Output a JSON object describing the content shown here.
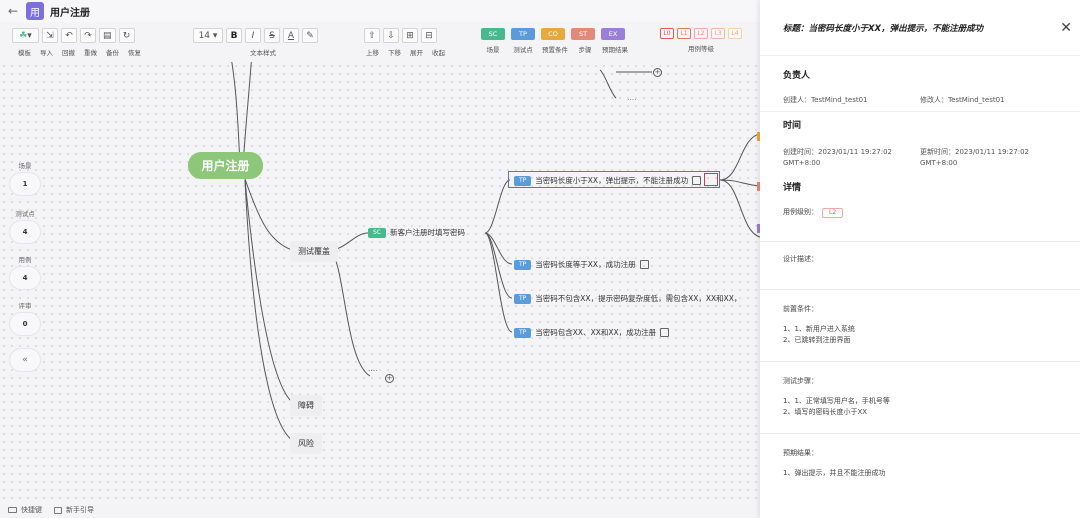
{
  "header": {
    "back_icon": "arrow-left-icon",
    "logo_text": "用",
    "title": "用户注册"
  },
  "toolbar": {
    "font_size": "14",
    "labels": {
      "template": "模板",
      "import": "导入",
      "undo": "回撤",
      "redo": "重做",
      "backup": "备份",
      "restore": "恢复",
      "text_style": "文本样式",
      "move_up": "上移",
      "move_down": "下移",
      "expand": "展开",
      "collapse": "收起",
      "scene": "场景",
      "test_point": "测试点",
      "precondition": "预置条件",
      "steps": "步骤",
      "expected": "预期结果",
      "case_level": "用例等级"
    },
    "tags": [
      {
        "text": "SC",
        "color": "#48b98c"
      },
      {
        "text": "TP",
        "color": "#5b9bd9"
      },
      {
        "text": "CO",
        "color": "#e6a93d"
      },
      {
        "text": "ST",
        "color": "#e2897a"
      },
      {
        "text": "EX",
        "color": "#9a7fd6"
      }
    ],
    "levels": [
      "L0",
      "L1",
      "L2",
      "L3",
      "L4"
    ]
  },
  "stats": [
    {
      "label": "场景",
      "value": "1"
    },
    {
      "label": "测试点",
      "value": "4"
    },
    {
      "label": "用例",
      "value": "4"
    },
    {
      "label": "评审",
      "value": "0"
    }
  ],
  "collapse_label": "«",
  "mindmap": {
    "root": "用户注册",
    "branches": [
      "测试覆盖",
      "障碍",
      "风险"
    ],
    "scene_chip": "SC",
    "scene": "新客户注册时填写密码",
    "tp_chip": "TP",
    "test_points": [
      "当密码长度小于XX，弹出提示，不能注册成功",
      "当密码长度等于XX，成功注册",
      "当密码不包含XX，提示密码复杂度低，需包含XX，XX和XX，",
      "当密码包含XX、XX和XX，成功注册"
    ],
    "ellipsis": "....",
    "top_ellipsis": "...."
  },
  "bottombar": {
    "shortcuts": "快捷键",
    "guide": "新手引导"
  },
  "panel": {
    "title": "标题：当密码长度小于XX，弹出提示，不能注册成功",
    "owner_heading": "负责人",
    "creator": "创建人：TestMind_test01",
    "modifier": "修改人：TestMind_test01",
    "time_heading": "时间",
    "created_time_1": "创建时间：2023/01/11 19:27:02",
    "created_time_2": "GMT+8:00",
    "updated_time_1": "更新时间：2023/01/11 19:27:02",
    "updated_time_2": "GMT+8:00",
    "detail_heading": "详情",
    "case_level_label": "用例级别：",
    "case_level_value": "L2",
    "design_label": "设计描述：",
    "precondition_label": "前置条件：",
    "precondition_lines": [
      "1、1、新用户进入系统",
      "2、已跳转到注册界面"
    ],
    "steps_label": "测试步骤：",
    "steps_lines": [
      "1、1、正常填写用户名，手机号等",
      "2、填写的密码长度小于XX"
    ],
    "expected_label": "预期结果：",
    "expected_lines": [
      "1、弹出提示，并且不能注册成功"
    ]
  }
}
